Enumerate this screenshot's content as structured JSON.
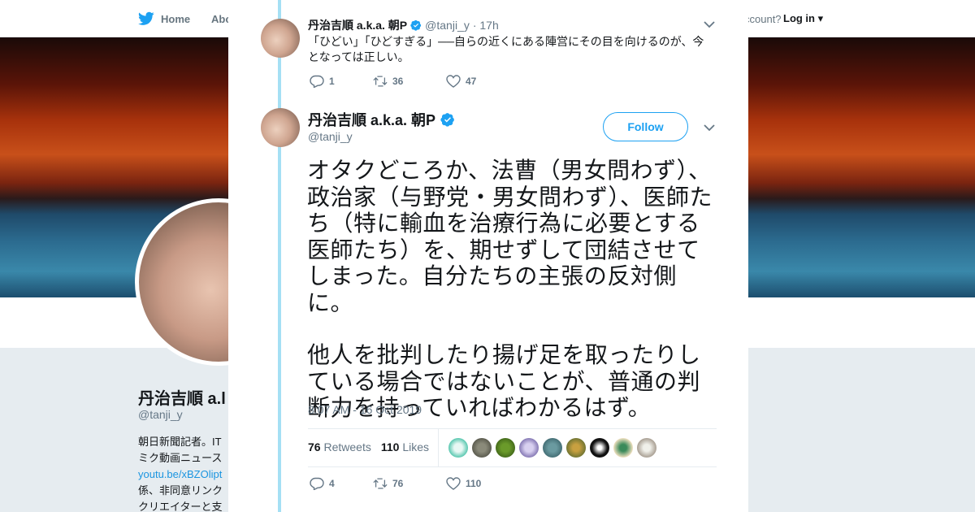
{
  "background": {
    "nav": {
      "home_label": "Home",
      "about_label": "Abo",
      "account_text": "ccount?",
      "login_label": "Log in"
    },
    "profile": {
      "name": "丹治吉順 a.k.a. 朝P",
      "name_visible": "丹治吉順 a.l",
      "handle": "@tanji_y",
      "bio_lines": [
        "朝日新聞記者。IT",
        "ミク動画ニュース",
        "youtu.be/xBZOlipt",
        "係、非同意リンク",
        "クリエイターと支"
      ]
    }
  },
  "modal": {
    "tweet1": {
      "name": "丹治吉順 a.k.a. 朝P",
      "handle": "@tanji_y",
      "time": "· 17h",
      "text": "「ひどい」「ひどすぎる」──自らの近くにある陣営にその目を向けるのが、今となっては正しい。",
      "replies": "1",
      "retweets": "36",
      "likes": "47"
    },
    "tweet2": {
      "name": "丹治吉順 a.k.a. 朝P",
      "handle": "@tanji_y",
      "follow_label": "Follow",
      "paragraph1": "オタクどころか、法曹（男女問わず）、政治家（与野党・男女問わず）、医師たち（特に輸血を治療行為に必要とする医師たち）を、期せずして団結させてしまった。自分たちの主張の反対側に。",
      "paragraph2": "他人を批判したり揚げ足を取ったりしている場合ではないことが、普通の判断力を持っていればわかるはず。",
      "timestamp": "8:07 AM - 16 Oct 2019",
      "retweets_count": "76",
      "retweets_label": "Retweets",
      "likes_count": "110",
      "likes_label": "Likes",
      "replies": "4",
      "retweets": "76",
      "likes": "110"
    },
    "colors": {
      "accent": "#1da1f2",
      "thread_line": "#a5e0f4",
      "verified": "#1da1f2",
      "muted": "#657786"
    }
  }
}
